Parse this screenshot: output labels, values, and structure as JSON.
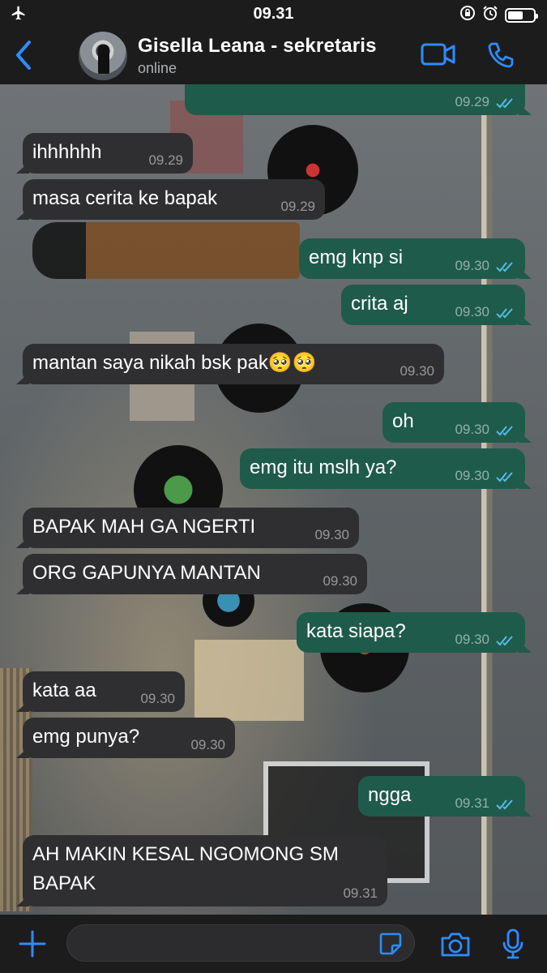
{
  "status_bar": {
    "time": "09.31",
    "airplane_icon": "airplane-icon",
    "rotation_lock_icon": "rotation-lock-icon",
    "alarm_icon": "alarm-icon",
    "battery_icon": "battery-icon",
    "battery_level_percent": 62
  },
  "header": {
    "back_icon": "chevron-left-icon",
    "contact_name": "Gisella Leana - sekretaris",
    "contact_status": "online",
    "video_icon": "video-camera-icon",
    "call_icon": "phone-icon"
  },
  "colors": {
    "accent": "#2d8cff",
    "incoming_bubble": "#2f2f31",
    "outgoing_bubble": "#1f5b4a",
    "read_ticks": "#53bdeb",
    "bar_background": "#1c1c1d"
  },
  "messages": [
    {
      "direction": "out",
      "text": "",
      "time": "09.29",
      "read": true
    },
    {
      "direction": "in",
      "text": "ihhhhhh",
      "time": "09.29"
    },
    {
      "direction": "in",
      "text": "masa cerita ke bapak",
      "time": "09.29"
    },
    {
      "direction": "out",
      "text": "emg knp si",
      "time": "09.30",
      "read": true
    },
    {
      "direction": "out",
      "text": "crita aj",
      "time": "09.30",
      "read": true
    },
    {
      "direction": "in",
      "text": "mantan saya nikah bsk pak🥺🥺",
      "time": "09.30"
    },
    {
      "direction": "out",
      "text": "oh",
      "time": "09.30",
      "read": true
    },
    {
      "direction": "out",
      "text": "emg itu mslh ya?",
      "time": "09.30",
      "read": true
    },
    {
      "direction": "in",
      "text": "BAPAK MAH GA NGERTI",
      "time": "09.30"
    },
    {
      "direction": "in",
      "text": "ORG GAPUNYA MANTAN",
      "time": "09.30"
    },
    {
      "direction": "out",
      "text": "kata siapa?",
      "time": "09.30",
      "read": true
    },
    {
      "direction": "in",
      "text": "kata aa",
      "time": "09.30"
    },
    {
      "direction": "in",
      "text": "emg punya?",
      "time": "09.30"
    },
    {
      "direction": "out",
      "text": "ngga",
      "time": "09.31",
      "read": true
    },
    {
      "direction": "in",
      "text_lines": [
        "AH MAKIN KESAL NGOMONG SM",
        "BAPAK"
      ],
      "time": "09.31"
    }
  ],
  "input_bar": {
    "plus_icon": "plus-icon",
    "input_placeholder": "",
    "sticker_icon": "sticker-icon",
    "camera_icon": "camera-icon",
    "mic_icon": "microphone-icon"
  }
}
